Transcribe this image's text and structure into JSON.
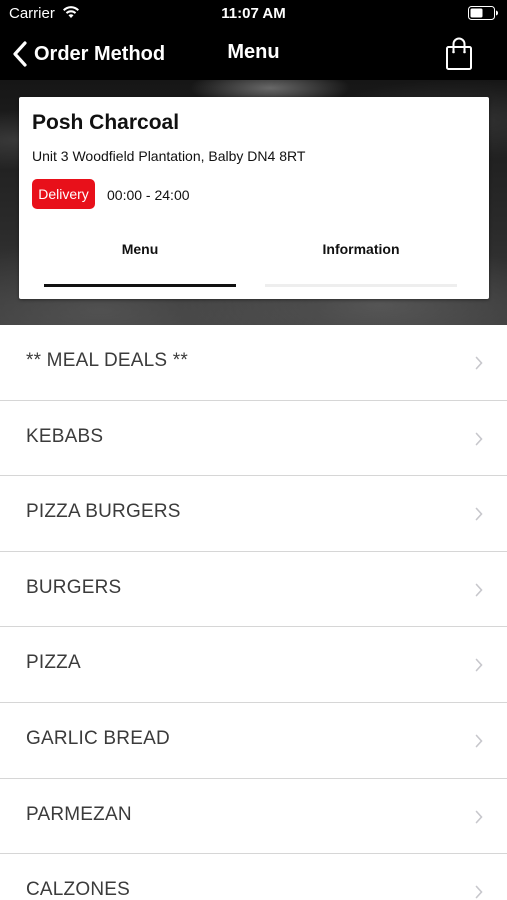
{
  "status_bar": {
    "carrier": "Carrier",
    "time": "11:07 AM",
    "wifi_icon": "wifi-icon",
    "battery_icon": "battery-icon"
  },
  "nav": {
    "back_label": "Order Method",
    "back_icon": "chevron-left-icon",
    "title": "Menu",
    "cart_icon": "shopping-bag-icon"
  },
  "restaurant": {
    "name": "Posh Charcoal",
    "address": "Unit 3 Woodfield Plantation, Balby DN4 8RT",
    "badge": "Delivery",
    "hours": "00:00 - 24:00"
  },
  "tabs": [
    {
      "label": "Menu",
      "active": true
    },
    {
      "label": "Information",
      "active": false
    }
  ],
  "categories": [
    "** MEAL DEALS **",
    "KEBABS",
    "PIZZA BURGERS",
    "BURGERS",
    "PIZZA",
    "GARLIC BREAD",
    "PARMEZAN",
    "CALZONES"
  ],
  "colors": {
    "bar_background": "#000000",
    "delivery_badge": "#e8101a",
    "active_tab_underline": "#111111",
    "divider": "#d6d6d6"
  }
}
